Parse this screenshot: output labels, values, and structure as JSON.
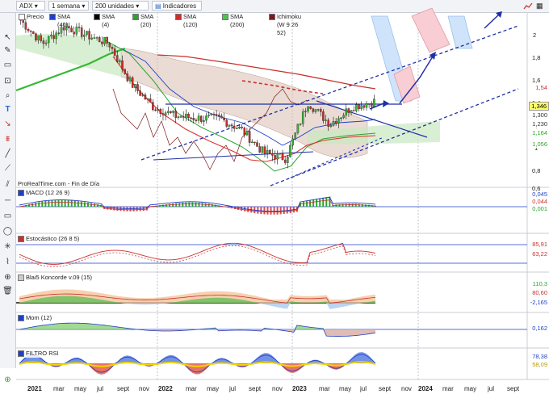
{
  "header": {
    "symbol": "ADX",
    "timeframe": "1 semana",
    "units": "200 unidades",
    "indicators_label": "Indicadores"
  },
  "legend": [
    {
      "label": "Precio",
      "color": "#ffffff"
    },
    {
      "label": "SMA (40)",
      "color": "#1f3fc9"
    },
    {
      "label": "SMA (4)",
      "color": "#000000"
    },
    {
      "label": "SMA (20)",
      "color": "#2aa52a"
    },
    {
      "label": "SMA (120)",
      "color": "#c9302c"
    },
    {
      "label": "SMA (200)",
      "color": "#48c848"
    },
    {
      "label": "Ichimoku (W 9 26 52)",
      "color": "#7a1a1a"
    }
  ],
  "source_label": "ProRealTime.com - Fin de Día",
  "panels": {
    "macd": {
      "title": "MACD (12 26 9)",
      "values": [
        "0,045",
        "0,044",
        "0,001"
      ],
      "colors": [
        "#1f3fc9",
        "#c9302c",
        "#2aa52a"
      ]
    },
    "stoch": {
      "title": "Estocástico (26 8 5)",
      "values": [
        "85,91",
        "63,22"
      ],
      "colors": [
        "#c9302c",
        "#c9302c"
      ]
    },
    "koncorde": {
      "title": "Blai5 Koncorde v.09 (15)",
      "values": [
        "110,3",
        "80,60",
        "-2,165"
      ],
      "colors": [
        "#2aa52a",
        "#c9302c",
        "#1f3fc9"
      ]
    },
    "mom": {
      "title": "Mom (12)",
      "values": [
        "0,162"
      ],
      "colors": [
        "#1f3fc9"
      ]
    },
    "rsi": {
      "title": "FILTRO RSI",
      "values": [
        "78,38",
        "58,09"
      ],
      "colors": [
        "#1f3fc9",
        "#e6c800"
      ]
    }
  },
  "price_axis": {
    "ticks": [
      "2",
      "1,8",
      "1,6",
      "1,4",
      "1,2",
      "1",
      "0,8",
      "0,6"
    ],
    "tags": [
      {
        "label": "1,54",
        "color": "#c9302c",
        "bg": "#ffffff"
      },
      {
        "label": "1,346",
        "color": "#000000",
        "bg": "#ffff66"
      },
      {
        "label": "1,300",
        "color": "#333333",
        "bg": "#ffffff"
      },
      {
        "label": "1,230",
        "color": "#333333",
        "bg": "#ffffff"
      },
      {
        "label": "1,164",
        "color": "#2aa52a",
        "bg": "#ffffff"
      },
      {
        "label": "1,056",
        "color": "#2aa52a",
        "bg": "#ffffff"
      }
    ]
  },
  "x_axis": [
    "2021",
    "mar",
    "may",
    "jul",
    "sept",
    "nov",
    "2022",
    "mar",
    "may",
    "jul",
    "sept",
    "nov",
    "2023",
    "mar",
    "may",
    "jul",
    "sept",
    "nov",
    "2024",
    "mar",
    "may",
    "jul",
    "sept"
  ],
  "chart_data": {
    "type": "line",
    "title": "ADX",
    "xlabel": "",
    "ylabel": "",
    "ylim": [
      0.6,
      2.1
    ],
    "x": [
      "2021-01",
      "2021-03",
      "2021-05",
      "2021-07",
      "2021-09",
      "2021-11",
      "2022-01",
      "2022-03",
      "2022-05",
      "2022-07",
      "2022-09",
      "2022-11",
      "2023-01",
      "2023-03",
      "2023-05",
      "2023-07",
      "2023-08"
    ],
    "series": [
      {
        "name": "Precio",
        "values": [
          2.05,
          1.85,
          2.0,
          1.92,
          1.85,
          1.5,
          1.3,
          1.22,
          1.2,
          1.2,
          1.1,
          0.9,
          0.85,
          1.34,
          1.15,
          1.3,
          1.346
        ]
      },
      {
        "name": "SMA (120)",
        "values": [
          null,
          null,
          null,
          null,
          null,
          null,
          1.68,
          1.72,
          1.69,
          1.66,
          1.63,
          1.61,
          1.59,
          1.58,
          1.56,
          1.55,
          1.54
        ]
      }
    ]
  }
}
